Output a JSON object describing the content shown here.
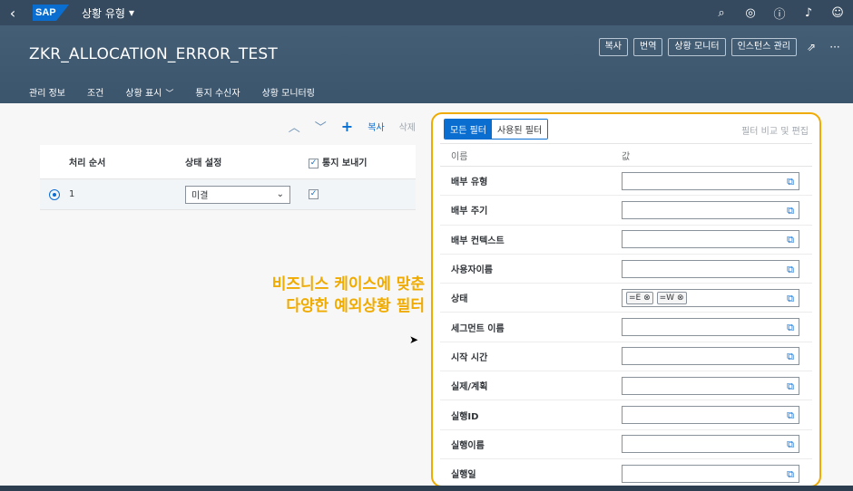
{
  "shell": {
    "back_icon": "back-icon",
    "logo_text": "SAP",
    "app_title": "상황 유형",
    "app_title_chevron": "▾",
    "icons": [
      "search-icon",
      "copilot-icon",
      "help-icon",
      "notification-icon",
      "user-icon"
    ]
  },
  "header": {
    "title": "ZKR_ALLOCATION_ERROR_TEST",
    "actions": [
      "복사",
      "번역",
      "상황 모니터",
      "인스턴스 관리"
    ],
    "share_icon": "share-icon",
    "more_icon": "more-icon"
  },
  "tabs": [
    {
      "label": "관리 정보",
      "active": false
    },
    {
      "label": "조건",
      "active": true
    },
    {
      "label": "상황 표시",
      "active": false,
      "has_chevron": true
    },
    {
      "label": "통지 수신자",
      "active": false
    },
    {
      "label": "상황 모니터링",
      "active": false
    }
  ],
  "left_table": {
    "toolbar": {
      "copy_label": "복사",
      "delete_label": "삭제"
    },
    "columns": [
      "처리 순서",
      "상태 설정",
      "통지 보내기"
    ],
    "rows": [
      {
        "order": "1",
        "status": "미결",
        "notify": true,
        "selected": true
      }
    ]
  },
  "annotation": {
    "line1": "비즈니스 케이스에 맞춘",
    "line2": "다양한 예외상황 필터"
  },
  "filters": {
    "seg_all": "모든 필터",
    "seg_used": "사용된 필터",
    "compare_label": "필터 비교 및 편집",
    "col_name": "이름",
    "col_value": "값",
    "rows": [
      {
        "name": "배부 유형",
        "tokens": []
      },
      {
        "name": "배부 주기",
        "tokens": []
      },
      {
        "name": "배부 컨텍스트",
        "tokens": []
      },
      {
        "name": "사용자이름",
        "tokens": []
      },
      {
        "name": "상태",
        "tokens": [
          "=E",
          "=W"
        ]
      },
      {
        "name": "세그먼트 이름",
        "tokens": []
      },
      {
        "name": "시작 시간",
        "tokens": []
      },
      {
        "name": "실제/계획",
        "tokens": []
      },
      {
        "name": "실행ID",
        "tokens": []
      },
      {
        "name": "실행이름",
        "tokens": []
      },
      {
        "name": "실행일",
        "tokens": []
      }
    ]
  },
  "colors": {
    "accent": "#0a6ed1",
    "highlight": "#f0ab00",
    "shell": "#354a5f"
  }
}
